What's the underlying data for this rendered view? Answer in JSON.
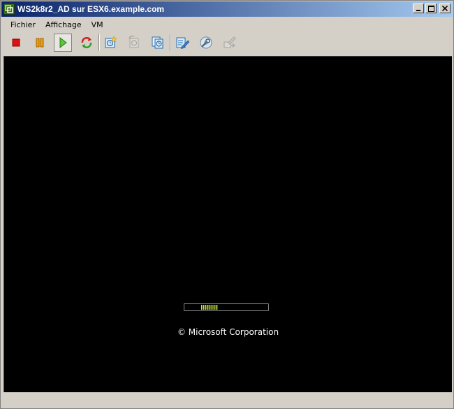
{
  "window": {
    "title": "WS2k8r2_AD sur ESX6.example.com"
  },
  "menubar": {
    "items": [
      "Fichier",
      "Affichage",
      "VM"
    ]
  },
  "toolbar": {
    "buttons": [
      {
        "name": "power-off",
        "icon": "stop-square-icon"
      },
      {
        "name": "suspend",
        "icon": "pause-icon"
      },
      {
        "name": "power-on",
        "icon": "play-icon",
        "pressed": true
      },
      {
        "name": "reset",
        "icon": "reset-arrows-icon"
      },
      {
        "name": "take-snapshot",
        "icon": "snapshot-take-icon"
      },
      {
        "name": "revert-snapshot",
        "icon": "snapshot-revert-icon",
        "disabled": true
      },
      {
        "name": "snapshot-manager",
        "icon": "snapshot-manager-icon"
      },
      {
        "name": "edit-settings",
        "icon": "edit-settings-icon"
      },
      {
        "name": "install-tools",
        "icon": "wrench-disc-icon"
      },
      {
        "name": "connect-devices",
        "icon": "devices-icon",
        "disabled": true
      }
    ]
  },
  "console": {
    "copyright": "© Microsoft Corporation",
    "progress_fraction": 0.2,
    "progress_color": "#c6e35c"
  },
  "colors": {
    "title_gradient_start": "#0a246a",
    "title_gradient_end": "#a6caf0",
    "chrome": "#d4d0c8",
    "console_bg": "#000000"
  }
}
